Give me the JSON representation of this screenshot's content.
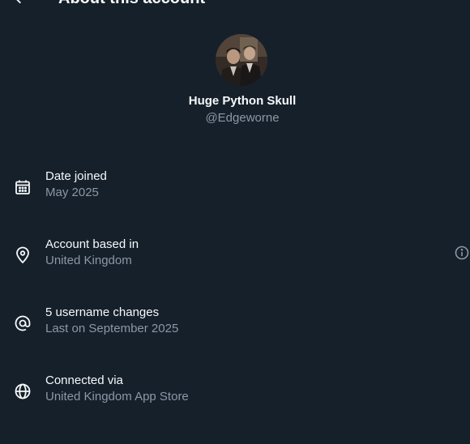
{
  "header": {
    "title": "About this account"
  },
  "profile": {
    "display_name": "Huge Python Skull",
    "handle": "@Edgeworne"
  },
  "rows": [
    {
      "icon": "calendar-icon",
      "title": "Date joined",
      "subtitle": "May 2025"
    },
    {
      "icon": "location-pin-icon",
      "title": "Account based in",
      "subtitle": "United Kingdom",
      "has_info": true
    },
    {
      "icon": "at-sign-icon",
      "title": "5 username changes",
      "subtitle": "Last on September 2025"
    },
    {
      "icon": "globe-icon",
      "title": "Connected via",
      "subtitle": "United Kingdom App Store"
    }
  ],
  "colors": {
    "background": "#15202b",
    "primary_text": "#f7f9f9",
    "secondary_text": "#8b98a5"
  }
}
